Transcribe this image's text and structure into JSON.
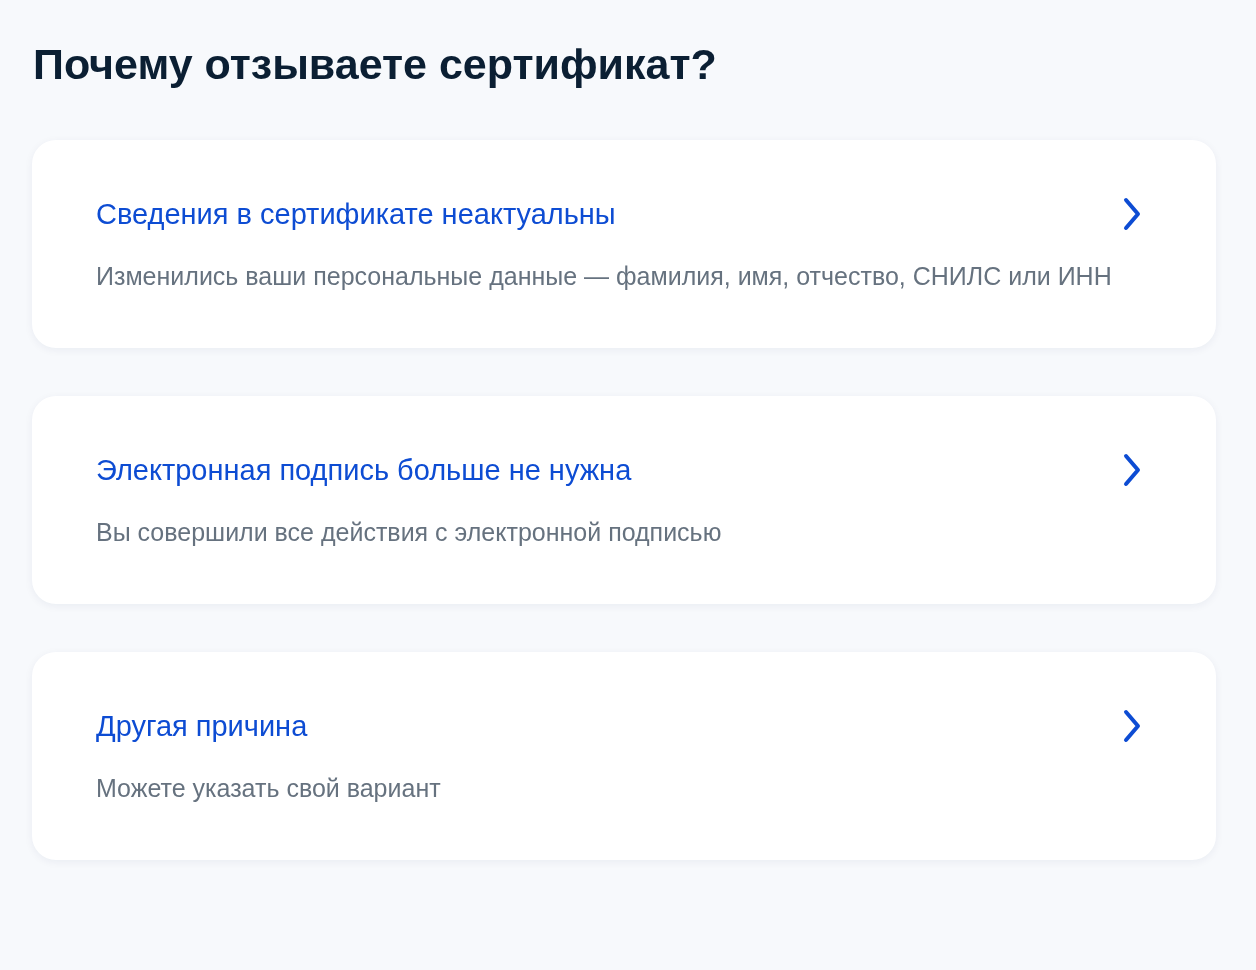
{
  "title": "Почему отзываете сертификат?",
  "reasons": [
    {
      "title": "Сведения в сертификате неактуальны",
      "description": "Изменились ваши персональные данные — фамилия, имя, отчество, СНИЛС или ИНН"
    },
    {
      "title": "Электронная подпись больше не нужна",
      "description": "Вы совершили все действия с электронной подписью"
    },
    {
      "title": "Другая причина",
      "description": "Можете указать свой вариант"
    }
  ]
}
